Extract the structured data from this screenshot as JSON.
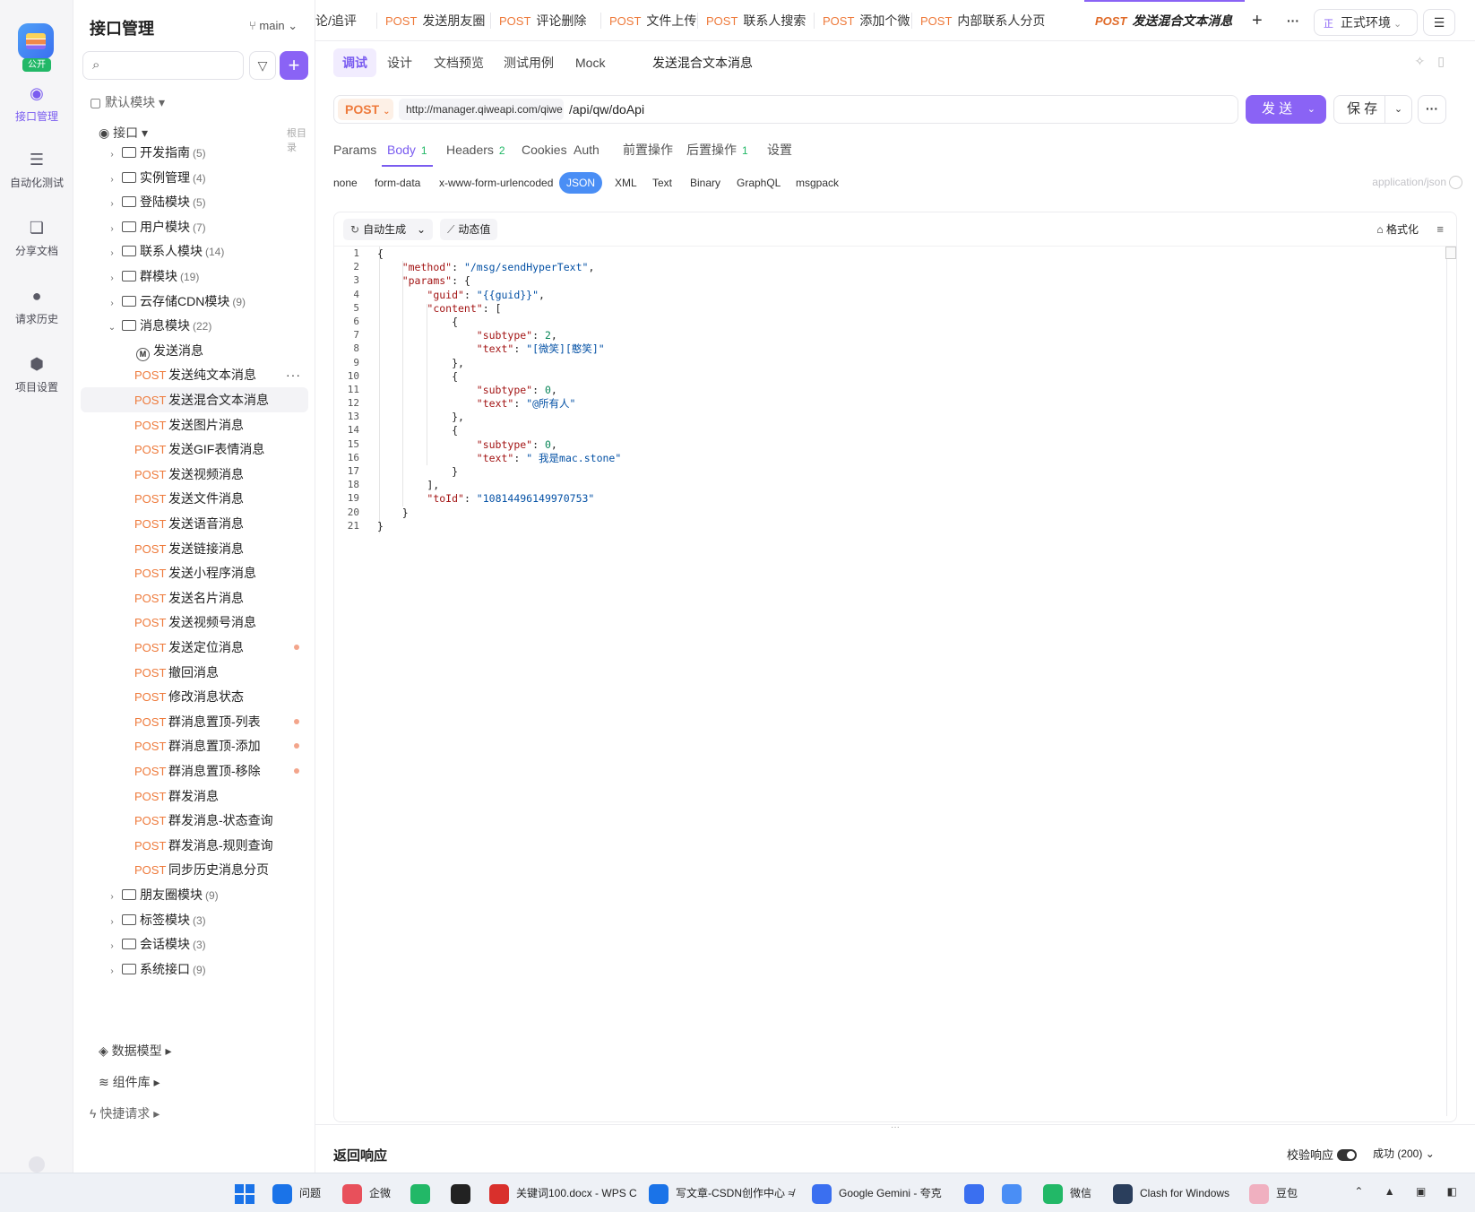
{
  "rail": {
    "public_badge": "公开",
    "items": [
      {
        "label": "接口管理",
        "icon": "api-icon"
      },
      {
        "label": "自动化测试",
        "icon": "automation-icon"
      },
      {
        "label": "分享文档",
        "icon": "book-icon"
      },
      {
        "label": "请求历史",
        "icon": "clock-icon"
      },
      {
        "label": "项目设置",
        "icon": "gear-icon"
      }
    ]
  },
  "tree": {
    "title": "接口管理",
    "branch": "main",
    "default_module": "默认模块",
    "interface_root": "接口",
    "root_tag": "根目录",
    "folders_top": [
      {
        "label": "开发指南",
        "count": "(5)"
      },
      {
        "label": "实例管理",
        "count": "(4)"
      },
      {
        "label": "登陆模块",
        "count": "(5)"
      },
      {
        "label": "用户模块",
        "count": "(7)"
      },
      {
        "label": "联系人模块",
        "count": "(14)"
      },
      {
        "label": "群模块",
        "count": "(19)"
      },
      {
        "label": "云存储CDN模块",
        "count": "(9)"
      },
      {
        "label": "消息模块",
        "count": "(22)"
      }
    ],
    "doc_item": "发送消息",
    "method": "POST",
    "endpoints": [
      "发送纯文本消息",
      "发送混合文本消息",
      "发送图片消息",
      "发送GIF表情消息",
      "发送视频消息",
      "发送文件消息",
      "发送语音消息",
      "发送链接消息",
      "发送小程序消息",
      "发送名片消息",
      "发送视频号消息",
      "发送定位消息",
      "撤回消息",
      "修改消息状态",
      "群消息置顶-列表",
      "群消息置顶-添加",
      "群消息置顶-移除",
      "群发消息",
      "群发消息-状态查询",
      "群发消息-规则查询",
      "同步历史消息分页"
    ],
    "folders_bottom": [
      {
        "label": "朋友圈模块",
        "count": "(9)"
      },
      {
        "label": "标签模块",
        "count": "(3)"
      },
      {
        "label": "会话模块",
        "count": "(3)"
      },
      {
        "label": "系统接口",
        "count": "(9)"
      }
    ],
    "data_model": "数据模型",
    "components": "组件库",
    "quick_request": "快捷请求"
  },
  "tabs": [
    {
      "method": "",
      "label": "论/追评"
    },
    {
      "method": "POST",
      "label": "发送朋友圈"
    },
    {
      "method": "POST",
      "label": "评论删除"
    },
    {
      "method": "POST",
      "label": "文件上传"
    },
    {
      "method": "POST",
      "label": "联系人搜索"
    },
    {
      "method": "POST",
      "label": "添加个微"
    },
    {
      "method": "POST",
      "label": "内部联系人分页"
    },
    {
      "method": "POST",
      "label": "发送混合文本消息"
    }
  ],
  "env": {
    "badge": "正",
    "label": "正式环境"
  },
  "subtabs": [
    "调试",
    "设计",
    "文档预览",
    "测试用例",
    "Mock"
  ],
  "subtitle": "发送混合文本消息",
  "request": {
    "method": "POST",
    "base_url": "http://manager.qiweapi.com/qiwe",
    "path": "/api/qw/doApi",
    "send_label": "发 送",
    "save_label": "保 存"
  },
  "param_tabs": [
    {
      "label": "Params",
      "count": ""
    },
    {
      "label": "Body",
      "count": "1"
    },
    {
      "label": "Headers",
      "count": "2"
    },
    {
      "label": "Cookies",
      "count": ""
    },
    {
      "label": "Auth",
      "count": ""
    },
    {
      "label": "前置操作",
      "count": ""
    },
    {
      "label": "后置操作",
      "count": "1"
    },
    {
      "label": "设置",
      "count": ""
    }
  ],
  "body_types": [
    "none",
    "form-data",
    "x-www-form-urlencoded",
    "JSON",
    "XML",
    "Text",
    "Binary",
    "GraphQL",
    "msgpack"
  ],
  "content_type": "application/json",
  "editor": {
    "auto_gen": "自动生成",
    "dynamic": "动态值",
    "format": "格式化"
  },
  "code_lines": [
    "{",
    "    \"method\": \"/msg/sendHyperText\",",
    "    \"params\": {",
    "        \"guid\": \"{{guid}}\",",
    "        \"content\": [",
    "            {",
    "                \"subtype\": 2,",
    "                \"text\": \"[微笑][憨笑]\"",
    "            },",
    "            {",
    "                \"subtype\": 0,",
    "                \"text\": \"@所有人\"",
    "            },",
    "            {",
    "                \"subtype\": 0,",
    "                \"text\": \" 我是mac.stone\"",
    "            }",
    "        ],",
    "        \"toId\": \"10814496149970753\"",
    "    }",
    "}"
  ],
  "response": {
    "title": "返回响应",
    "verify": "校验响应",
    "status": "成功 (200)"
  },
  "taskbar": [
    {
      "label": "问题",
      "color": "#1a73e8"
    },
    {
      "label": "企微",
      "color": "#e8505b"
    },
    {
      "label": "",
      "color": "#22b867"
    },
    {
      "label": "",
      "color": "#222222"
    },
    {
      "label": "关键词100.docx - WPS C",
      "color": "#d9302c"
    },
    {
      "label": "写文章-CSDN创作中心 ≉",
      "color": "#1a73e8"
    },
    {
      "label": "Google Gemini - 夸克",
      "color": "#3a6ff0"
    },
    {
      "label": "",
      "color": "#3a6ff0"
    },
    {
      "label": "",
      "color": "#4a8ef5"
    },
    {
      "label": "微信",
      "color": "#22b867"
    },
    {
      "label": "Clash for Windows",
      "color": "#2a3e5c"
    },
    {
      "label": "豆包",
      "color": "#f0b0c0"
    }
  ]
}
